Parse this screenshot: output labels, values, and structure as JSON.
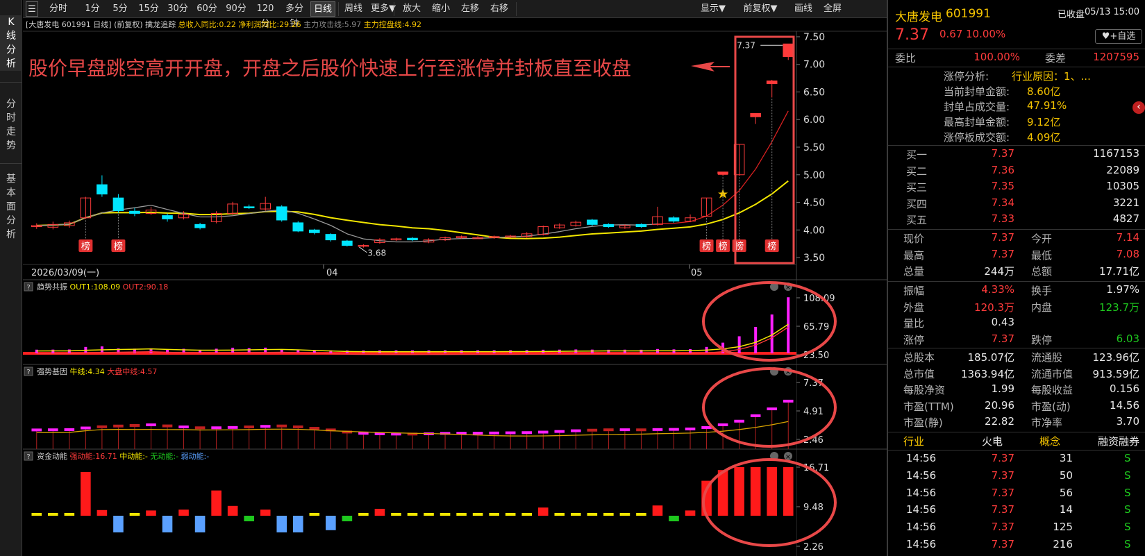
{
  "leftbar": {
    "tabs": [
      "K线分析",
      "分时走势",
      "基本面分析"
    ]
  },
  "toolbar": {
    "icon": "☰",
    "left": [
      "分时",
      "1分",
      "5分",
      "15分",
      "30分",
      "60分",
      "90分",
      "120分",
      "多分钟",
      "日线",
      "周线",
      "更多▼",
      "放大",
      "缩小",
      "左移",
      "右移"
    ],
    "active": "日线",
    "right": [
      "显示▼",
      "前复权▼",
      "画线",
      "全屏"
    ]
  },
  "main_header": {
    "title": "[大唐发电 601991 日线]",
    "adj": "(前复权)",
    "indicator": "擒龙追踪",
    "f1": "总收入同比:0.22",
    "f2": "净利润同比:29.26",
    "f3": "主力攻击线:5.97",
    "f4": "主力控盘线:4.92"
  },
  "annotation": "股价早盘跳空高开开盘，开盘之后股价快速上行至涨停并封板直至收盘",
  "rank_badge": "榜",
  "price_axis": [
    "7.50",
    "7.00",
    "6.50",
    "6.00",
    "5.50",
    "5.00",
    "4.50",
    "4.00",
    "3.50"
  ],
  "date_axis": {
    "start": "2026/03/09(一)",
    "apr": "04",
    "may": "05"
  },
  "low_label": "3.68",
  "high_label": "7.37",
  "panel1": {
    "name": "趋势共振",
    "out1": "OUT1:108.09",
    "out2": "OUT2:90.18",
    "axis": [
      "108.09",
      "65.79",
      "23.50"
    ]
  },
  "panel2": {
    "name": "强势基因",
    "l1": "牛线:4.34",
    "l2": "大盘中线:4.57",
    "axis": [
      "7.37",
      "4.91",
      "2.46"
    ]
  },
  "panel3": {
    "name": "资金动能",
    "l1": "强动能:16.71",
    "l2": "中动能:-",
    "l3": "无动能:-",
    "l4": "弱动能:-",
    "axis": [
      "16.71",
      "9.48",
      "2.26"
    ]
  },
  "help_icon": "?",
  "colors": {
    "up": "#ff3b3b",
    "down": "#00e5ff",
    "ma": "#f2e600",
    "accent": "#e84848"
  },
  "chart_data": {
    "type": "candlestick",
    "symbol": "601991",
    "period": "日线",
    "ylim": [
      3.4,
      7.6
    ],
    "candles": [
      {
        "o": 4.06,
        "c": 4.08,
        "h": 4.12,
        "l": 4.02
      },
      {
        "o": 4.05,
        "c": 4.1,
        "h": 4.15,
        "l": 4.01
      },
      {
        "o": 4.08,
        "c": 4.13,
        "h": 4.17,
        "l": 4.04
      },
      {
        "o": 4.22,
        "c": 4.58,
        "h": 4.6,
        "l": 4.2
      },
      {
        "o": 4.82,
        "c": 4.65,
        "h": 4.99,
        "l": 4.6
      },
      {
        "o": 4.58,
        "c": 4.35,
        "h": 4.65,
        "l": 4.31
      },
      {
        "o": 4.34,
        "c": 4.3,
        "h": 4.4,
        "l": 4.25
      },
      {
        "o": 4.3,
        "c": 4.36,
        "h": 4.42,
        "l": 4.27
      },
      {
        "o": 4.26,
        "c": 4.2,
        "h": 4.3,
        "l": 4.15
      },
      {
        "o": 4.22,
        "c": 4.28,
        "h": 4.34,
        "l": 4.19
      },
      {
        "o": 4.1,
        "c": 4.04,
        "h": 4.13,
        "l": 4.01
      },
      {
        "o": 4.15,
        "c": 4.3,
        "h": 4.34,
        "l": 4.12
      },
      {
        "o": 4.3,
        "c": 4.47,
        "h": 4.51,
        "l": 4.27
      },
      {
        "o": 4.42,
        "c": 4.4,
        "h": 4.46,
        "l": 4.38
      },
      {
        "o": 4.38,
        "c": 4.48,
        "h": 4.6,
        "l": 4.35
      },
      {
        "o": 4.42,
        "c": 4.18,
        "h": 4.45,
        "l": 4.15
      },
      {
        "o": 4.13,
        "c": 3.98,
        "h": 4.16,
        "l": 3.96
      },
      {
        "o": 4.0,
        "c": 3.95,
        "h": 4.02,
        "l": 3.92
      },
      {
        "o": 3.92,
        "c": 3.82,
        "h": 3.94,
        "l": 3.79
      },
      {
        "o": 3.8,
        "c": 3.72,
        "h": 3.82,
        "l": 3.7
      },
      {
        "o": 3.71,
        "c": 3.72,
        "h": 3.74,
        "l": 3.68
      },
      {
        "o": 3.77,
        "c": 3.82,
        "h": 3.85,
        "l": 3.75
      },
      {
        "o": 3.82,
        "c": 3.84,
        "h": 3.86,
        "l": 3.8
      },
      {
        "o": 3.85,
        "c": 3.82,
        "h": 3.87,
        "l": 3.8
      },
      {
        "o": 3.78,
        "c": 3.82,
        "h": 3.85,
        "l": 3.76
      },
      {
        "o": 3.82,
        "c": 3.86,
        "h": 3.88,
        "l": 3.8
      },
      {
        "o": 3.86,
        "c": 3.88,
        "h": 3.9,
        "l": 3.84
      },
      {
        "o": 3.86,
        "c": 3.86,
        "h": 3.89,
        "l": 3.84
      },
      {
        "o": 3.86,
        "c": 3.88,
        "h": 3.9,
        "l": 3.84
      },
      {
        "o": 3.88,
        "c": 3.89,
        "h": 3.91,
        "l": 3.86
      },
      {
        "o": 3.88,
        "c": 3.93,
        "h": 3.96,
        "l": 3.86
      },
      {
        "o": 3.92,
        "c": 4.06,
        "h": 4.08,
        "l": 3.9
      },
      {
        "o": 4.04,
        "c": 4.09,
        "h": 4.12,
        "l": 4.02
      },
      {
        "o": 4.08,
        "c": 4.14,
        "h": 4.17,
        "l": 4.06
      },
      {
        "o": 4.18,
        "c": 4.1,
        "h": 4.2,
        "l": 4.07
      },
      {
        "o": 4.1,
        "c": 4.06,
        "h": 4.12,
        "l": 4.04
      },
      {
        "o": 4.04,
        "c": 4.08,
        "h": 4.1,
        "l": 4.02
      },
      {
        "o": 4.1,
        "c": 4.06,
        "h": 4.12,
        "l": 4.04
      },
      {
        "o": 4.1,
        "c": 4.24,
        "h": 4.42,
        "l": 4.08
      },
      {
        "o": 4.22,
        "c": 4.16,
        "h": 4.25,
        "l": 4.13
      },
      {
        "o": 4.16,
        "c": 4.22,
        "h": 4.28,
        "l": 4.14
      },
      {
        "o": 4.25,
        "c": 4.58,
        "h": 4.58,
        "l": 4.24
      },
      {
        "o": 5.02,
        "c": 5.05,
        "h": 5.05,
        "l": 4.98
      },
      {
        "o": 5.0,
        "c": 5.55,
        "h": 5.55,
        "l": 4.98
      },
      {
        "o": 6.05,
        "c": 6.11,
        "h": 6.11,
        "l": 5.92
      },
      {
        "o": 6.65,
        "c": 6.7,
        "h": 6.72,
        "l": 6.4
      },
      {
        "o": 7.14,
        "c": 7.37,
        "h": 7.37,
        "l": 7.08
      }
    ]
  },
  "quote": {
    "name": "大唐发电",
    "code": "601991",
    "status": "已收盘",
    "time": "05/13 15:00",
    "price": "7.37",
    "change": "0.67",
    "pct": "10.00%",
    "watch_label": "+自选",
    "wb_label": "委比",
    "wb": "100.00%",
    "wc_label": "委差",
    "wc": "1207595",
    "limit_info": [
      [
        "涨停分析:",
        "行业原因：1、..."
      ],
      [
        "当前封单金额:",
        "8.60亿"
      ],
      [
        "封单占成交量:",
        "47.91%"
      ],
      [
        "最高封单金额:",
        "9.12亿"
      ],
      [
        "涨停板成交额:",
        "4.09亿"
      ]
    ],
    "bids": [
      [
        "买一",
        "7.37",
        "1167153"
      ],
      [
        "买二",
        "7.36",
        "22089"
      ],
      [
        "买三",
        "7.35",
        "10305"
      ],
      [
        "买四",
        "7.34",
        "3221"
      ],
      [
        "买五",
        "7.33",
        "4827"
      ]
    ],
    "stats1": [
      [
        "现价",
        "7.37",
        "今开",
        "7.14"
      ],
      [
        "最高",
        "7.37",
        "最低",
        "7.08"
      ],
      [
        "总量",
        "244万",
        "总额",
        "17.71亿"
      ]
    ],
    "stats2": [
      [
        "振幅",
        "4.33%",
        "换手",
        "1.97%"
      ],
      [
        "外盘",
        "120.3万",
        "内盘",
        "123.7万"
      ],
      [
        "量比",
        "0.43",
        "",
        ""
      ],
      [
        "涨停",
        "7.37",
        "跌停",
        "6.03"
      ]
    ],
    "stats3": [
      [
        "总股本",
        "185.07亿",
        "流通股",
        "123.96亿"
      ],
      [
        "总市值",
        "1363.94亿",
        "流通市值",
        "913.59亿"
      ],
      [
        "每股净资",
        "1.99",
        "每股收益",
        "0.156"
      ],
      [
        "市盈(TTM)",
        "20.96",
        "市盈(动)",
        "14.56"
      ],
      [
        "市盈(静)",
        "22.82",
        "市净率",
        "3.70"
      ]
    ],
    "tags": [
      "行业",
      "火电",
      "概念",
      "融资融券"
    ],
    "ticks": [
      [
        "14:56",
        "7.37",
        "31",
        "S"
      ],
      [
        "14:56",
        "7.37",
        "50",
        "S"
      ],
      [
        "14:56",
        "7.37",
        "56",
        "S"
      ],
      [
        "14:56",
        "7.37",
        "14",
        "S"
      ],
      [
        "14:56",
        "7.37",
        "125",
        "S"
      ],
      [
        "14:56",
        "7.37",
        "216",
        "S"
      ]
    ]
  }
}
